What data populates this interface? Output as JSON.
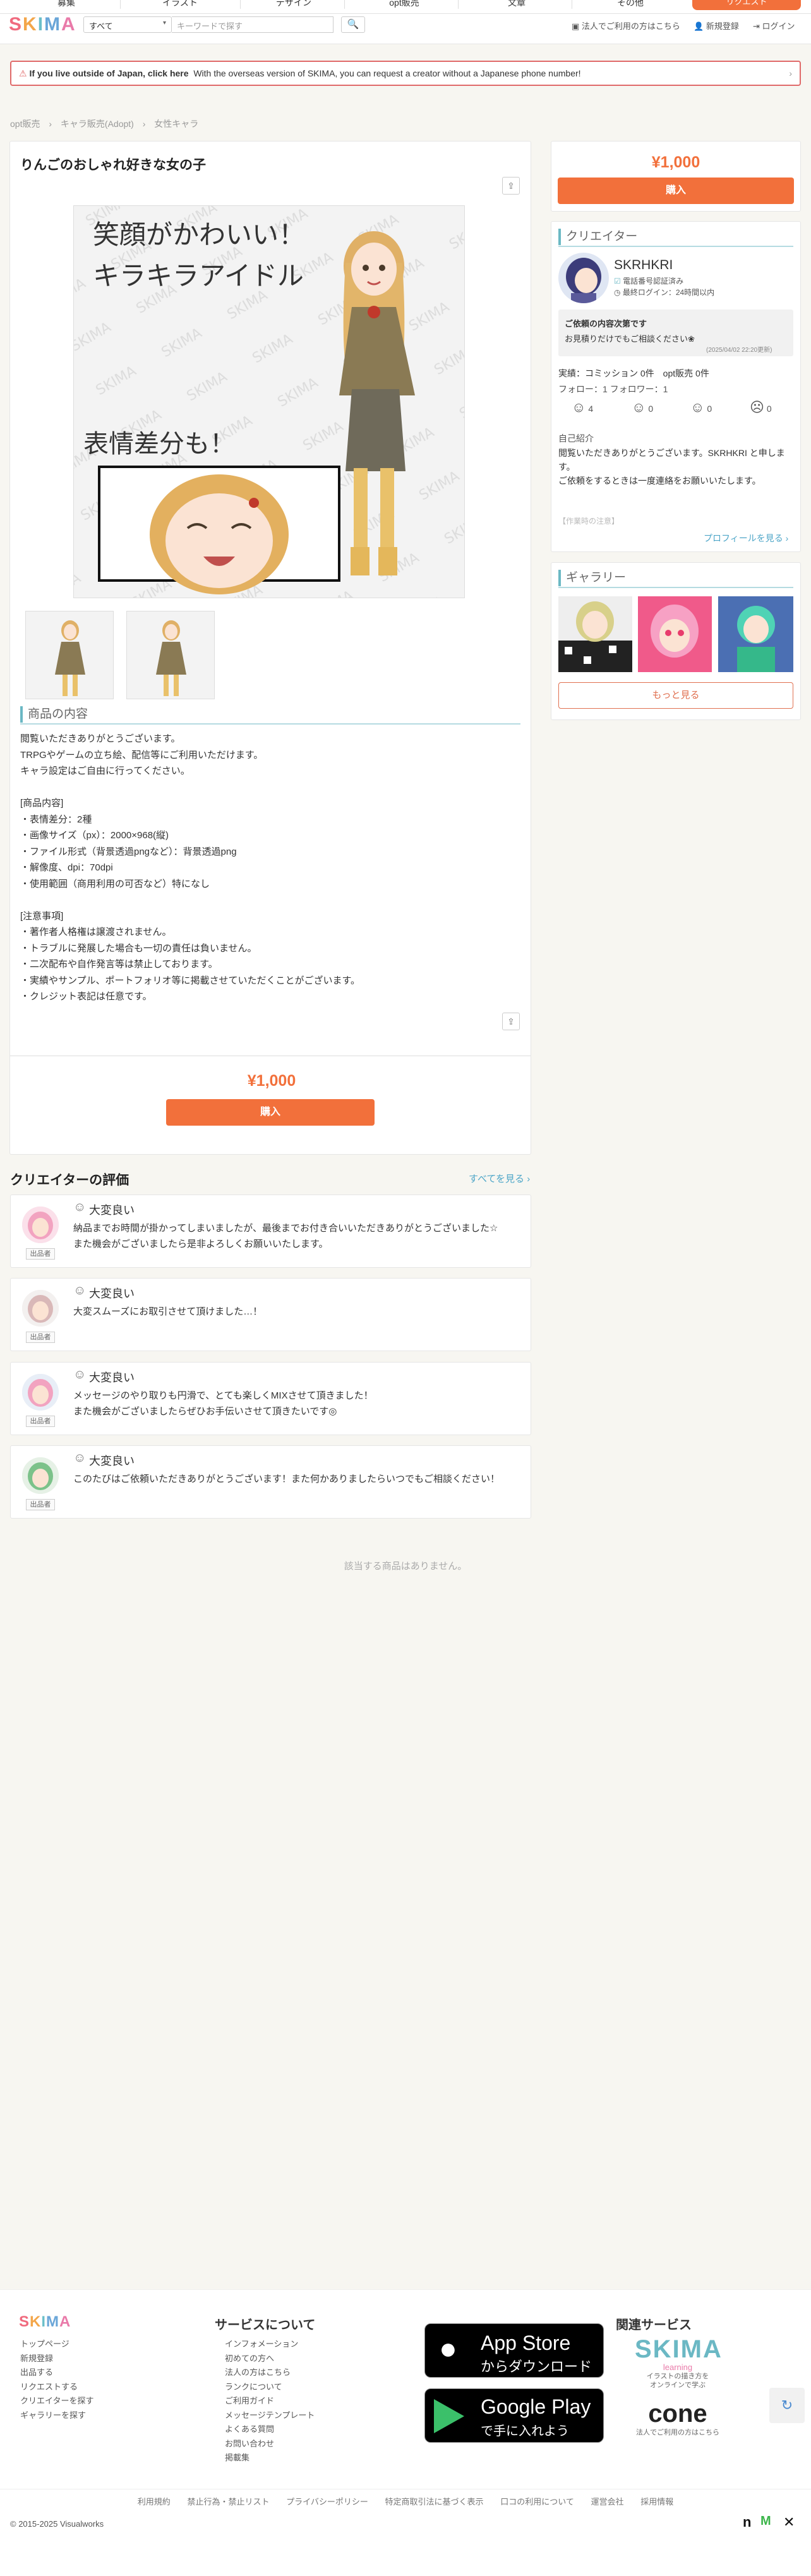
{
  "topnav": {
    "items": [
      "募集",
      "イラスト",
      "デザイン",
      "opt販売",
      "文章",
      "その他"
    ],
    "cta": "リクエスト"
  },
  "header": {
    "logo": "SKIMA",
    "category": "すべて",
    "search_placeholder": "キーワードで探す",
    "links": [
      "法人でご利用の方はこちら",
      "新規登録",
      "ログイン"
    ]
  },
  "notice": {
    "bold": "If you live outside of Japan, click here",
    "text": "With the overseas version of SKIMA, you can request a creator without a Japanese phone number!"
  },
  "breadcrumb": [
    "opt販売",
    "キャラ販売(Adopt)",
    "女性キャラ"
  ],
  "product": {
    "title": "りんごのおしゃれ好きな女の子",
    "image_text_1": "笑顔がかわいい！",
    "image_text_2": "キラキラアイドル",
    "image_text_3": "表情差分も！",
    "section_heading": "商品の内容",
    "description": "閲覧いただきありがとうございます。\nTRPGやゲームの立ち絵、配信等にご利用いただけます。\nキャラ設定はご自由に行ってください。\n\n[商品内容]\n・表情差分：2種\n・画像サイズ（px）：2000×968(縦)\n・ファイル形式（背景透過pngなど）：背景透過png\n・解像度、dpi：70dpi\n・使用範囲（商用利用の可否など）特になし\n\n[注意事項]\n・著作者人格権は譲渡されません。\n・トラブルに発展した場合も一切の責任は負いません。\n・二次配布や自作発言等は禁止しております。\n・実績やサンプル、ポートフォリオ等に掲載させていただくことがございます。\n・クレジット表記は任意です。",
    "price": "¥1,000",
    "buy_label": "購入"
  },
  "sidebar": {
    "price": "¥1,000",
    "buy_label": "購入",
    "creator_heading": "クリエイター",
    "creator_name": "SKRHKRI",
    "verified": "電話番号認証済み",
    "last_login": "最終ログイン：24時間以内",
    "consult_title": "ご依頼の内容次第です",
    "consult_text": "お見積りだけでもご相談ください❀",
    "consult_date": "(2025/04/02 22:20更新)",
    "stats": "実績：コミッション 0件　opt販売 0件",
    "follow": "フォロー：1 フォロワー：1",
    "ratings": [
      "4",
      "0",
      "0",
      "0"
    ],
    "intro_heading": "自己紹介",
    "intro_text": "閲覧いただきありがとうございます。SKRHKRI と申します。\nご依頼をするときは一度連絡をお願いいたします。",
    "intro_more": "【作業時の注意】",
    "profile_link": "プロフィールを見る ›",
    "gallery_heading": "ギャラリー",
    "more_button": "もっと見る"
  },
  "reviews": {
    "heading": "クリエイターの評価",
    "see_all": "すべてを見る ›",
    "badge": "出品者",
    "items": [
      {
        "label": "大変良い",
        "text": "納品までお時間が掛かってしまいましたが、最後までお付き合いいただきありがとうございました☆\nまた機会がございましたら是非よろしくお願いいたします。"
      },
      {
        "label": "大変良い",
        "text": "大変スムーズにお取引させて頂けました…！"
      },
      {
        "label": "大変良い",
        "text": "メッセージのやり取りも円滑で、とても楽しくMIXさせて頂きました！\nまた機会がございましたらぜひお手伝いさせて頂きたいです◎"
      },
      {
        "label": "大変良い",
        "text": "このたびはご依頼いただきありがとうございます！また何かありましたらいつでもご相談ください！"
      }
    ]
  },
  "related_empty": "該当する商品はありません。",
  "footer": {
    "logo": "SKIMA",
    "col1": [
      "トップページ",
      "新規登録",
      "出品する",
      "リクエストする",
      "クリエイターを探す",
      "ギャラリーを探す"
    ],
    "service_heading": "サービスについて",
    "col2": [
      "インフォメーション",
      "初めての方へ",
      "法人の方はこちら",
      "ランクについて",
      "ご利用ガイド",
      "メッセージテンプレート",
      "よくある質問",
      "お問い合わせ",
      "掲載集"
    ],
    "appstore_1": "App Store",
    "appstore_2": "からダウンロード",
    "gplay_1": "Google Play",
    "gplay_2": "で手に入れよう",
    "related_heading": "関連サービス",
    "skima_learning": "SKIMA",
    "learning": "learning",
    "learning_desc": "イラストの描き方を\nオンラインで学ぶ",
    "cone": "cone",
    "cone_desc": "法人でご利用の方はこちら",
    "bottom_links": [
      "利用規約",
      "禁止行為・禁止リスト",
      "プライバシーポリシー",
      "特定商取引法に基づく表示",
      "口コの利用について",
      "運営会社",
      "採用情報"
    ],
    "copyright": "© 2015-2025 Visualworks"
  },
  "colors": {
    "accent": "#f2703b",
    "teal": "#6bb8c4",
    "link": "#4ea6c8"
  }
}
